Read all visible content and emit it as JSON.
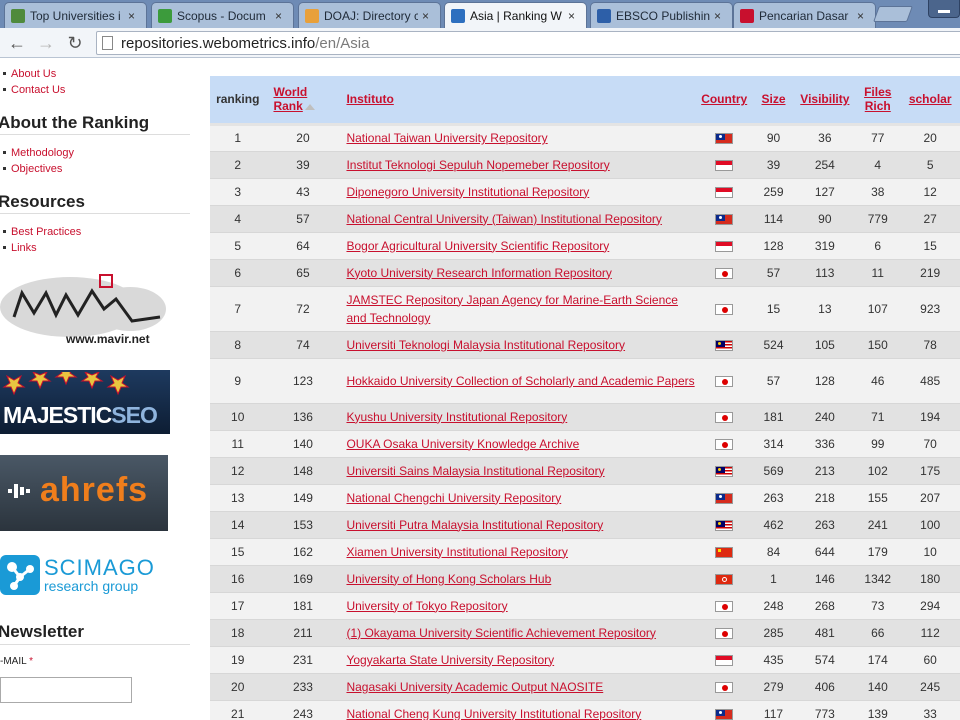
{
  "browser": {
    "tabs": [
      {
        "title": "Top Universities i",
        "favicon": "4icu-favicon",
        "color": "#4f8a3c"
      },
      {
        "title": "Scopus - Docum",
        "favicon": "scopus-favicon",
        "color": "#3c9b3c"
      },
      {
        "title": "DOAJ: Directory c",
        "favicon": "doaj-favicon",
        "color": "#e8a03a"
      },
      {
        "title": "Asia | Ranking W",
        "favicon": "webometrics-favicon",
        "color": "#2d6fbf"
      },
      {
        "title": "EBSCO Publishin",
        "favicon": "ebsco-favicon",
        "color": "#2d5fa8"
      },
      {
        "title": "Pencarian Dasar",
        "favicon": "q-favicon",
        "color": "#c8102e"
      }
    ],
    "url_host": "repositories.webometrics.info",
    "url_path": "/en/Asia"
  },
  "sidebar": {
    "top_links": [
      "About Us",
      "Contact Us"
    ],
    "about_heading": "About the Ranking",
    "about_links": [
      "Methodology",
      "Objectives"
    ],
    "resources_heading": "Resources",
    "resources_links": [
      "Best Practices",
      "Links"
    ],
    "mavir_logo_text": "www.mavir.net",
    "majestic_logo_text": "MAJESTIC",
    "majestic_logo_suffix": "SEO",
    "ahrefs_logo_text": "ahrefs",
    "scimago_logo_text": "SCIMAGO",
    "scimago_logo_sub": "research group",
    "newsletter_heading": "Newsletter",
    "email_label": "-MAIL",
    "email_required": "*",
    "email_value": ""
  },
  "table": {
    "headers": {
      "ranking": "ranking",
      "world_rank_1": "World",
      "world_rank_2": "Rank",
      "instituto": "Instituto",
      "country": "Country",
      "size": "Size",
      "visibility": "Visibility",
      "files_1": "Files",
      "files_2": "Rich",
      "scholar": "scholar"
    },
    "rows": [
      {
        "ranking": "1",
        "world": "20",
        "name": "National Taiwan University Repository",
        "country": "taiwan",
        "size": "90",
        "visibility": "36",
        "files": "77",
        "scholar": "20"
      },
      {
        "ranking": "2",
        "world": "39",
        "name": "Institut Teknologi Sepuluh Nopemeber Repository",
        "country": "indonesia",
        "size": "39",
        "visibility": "254",
        "files": "4",
        "scholar": "5"
      },
      {
        "ranking": "3",
        "world": "43",
        "name": "Diponegoro University Institutional Repository",
        "country": "indonesia",
        "size": "259",
        "visibility": "127",
        "files": "38",
        "scholar": "12"
      },
      {
        "ranking": "4",
        "world": "57",
        "name": "National Central University (Taiwan) Institutional Repository",
        "country": "taiwan",
        "size": "114",
        "visibility": "90",
        "files": "779",
        "scholar": "27"
      },
      {
        "ranking": "5",
        "world": "64",
        "name": "Bogor Agricultural University Scientific Repository",
        "country": "indonesia",
        "size": "128",
        "visibility": "319",
        "files": "6",
        "scholar": "15"
      },
      {
        "ranking": "6",
        "world": "65",
        "name": "Kyoto University Research Information Repository",
        "country": "japan",
        "size": "57",
        "visibility": "113",
        "files": "11",
        "scholar": "219"
      },
      {
        "ranking": "7",
        "world": "72",
        "name": "JAMSTEC Repository Japan Agency for Marine-Earth Science and Technology",
        "country": "japan",
        "size": "15",
        "visibility": "13",
        "files": "107",
        "scholar": "923",
        "tall": true
      },
      {
        "ranking": "8",
        "world": "74",
        "name": "Universiti Teknologi Malaysia Institutional Repository",
        "country": "malaysia",
        "size": "524",
        "visibility": "105",
        "files": "150",
        "scholar": "78"
      },
      {
        "ranking": "9",
        "world": "123",
        "name": "Hokkaido University Collection of Scholarly and Academic Papers",
        "country": "japan",
        "size": "57",
        "visibility": "128",
        "files": "46",
        "scholar": "485",
        "tall": true
      },
      {
        "ranking": "10",
        "world": "136",
        "name": "Kyushu University Institutional Repository",
        "country": "japan",
        "size": "181",
        "visibility": "240",
        "files": "71",
        "scholar": "194"
      },
      {
        "ranking": "11",
        "world": "140",
        "name": "OUKA Osaka University Knowledge Archive",
        "country": "japan",
        "size": "314",
        "visibility": "336",
        "files": "99",
        "scholar": "70"
      },
      {
        "ranking": "12",
        "world": "148",
        "name": "Universiti Sains Malaysia Institutional Repository",
        "country": "malaysia",
        "size": "569",
        "visibility": "213",
        "files": "102",
        "scholar": "175"
      },
      {
        "ranking": "13",
        "world": "149",
        "name": "National Chengchi University Repository",
        "country": "taiwan",
        "size": "263",
        "visibility": "218",
        "files": "155",
        "scholar": "207"
      },
      {
        "ranking": "14",
        "world": "153",
        "name": "Universiti Putra Malaysia Institutional Repository",
        "country": "malaysia",
        "size": "462",
        "visibility": "263",
        "files": "241",
        "scholar": "100"
      },
      {
        "ranking": "15",
        "world": "162",
        "name": "Xiamen University Institutional Repository",
        "country": "china",
        "size": "84",
        "visibility": "644",
        "files": "179",
        "scholar": "10"
      },
      {
        "ranking": "16",
        "world": "169",
        "name": "University of Hong Kong Scholars Hub",
        "country": "hongkong",
        "size": "1",
        "visibility": "146",
        "files": "1342",
        "scholar": "180"
      },
      {
        "ranking": "17",
        "world": "181",
        "name": "University of Tokyo Repository",
        "country": "japan",
        "size": "248",
        "visibility": "268",
        "files": "73",
        "scholar": "294"
      },
      {
        "ranking": "18",
        "world": "211",
        "name": "(1) Okayama University Scientific Achievement Repository",
        "country": "japan",
        "size": "285",
        "visibility": "481",
        "files": "66",
        "scholar": "112"
      },
      {
        "ranking": "19",
        "world": "231",
        "name": "Yogyakarta State University Repository",
        "country": "indonesia",
        "size": "435",
        "visibility": "574",
        "files": "174",
        "scholar": "60"
      },
      {
        "ranking": "20",
        "world": "233",
        "name": "Nagasaki University Academic Output NAOSITE",
        "country": "japan",
        "size": "279",
        "visibility": "406",
        "files": "140",
        "scholar": "245"
      },
      {
        "ranking": "21",
        "world": "243",
        "name": "National Cheng Kung University Institutional Repository",
        "country": "taiwan",
        "size": "117",
        "visibility": "773",
        "files": "139",
        "scholar": "33"
      }
    ]
  },
  "colors": {
    "link": "#c8102e",
    "header_bg": "#c7dcf6",
    "row_light": "#f2f2f2",
    "row_dark": "#e2e2e2"
  }
}
